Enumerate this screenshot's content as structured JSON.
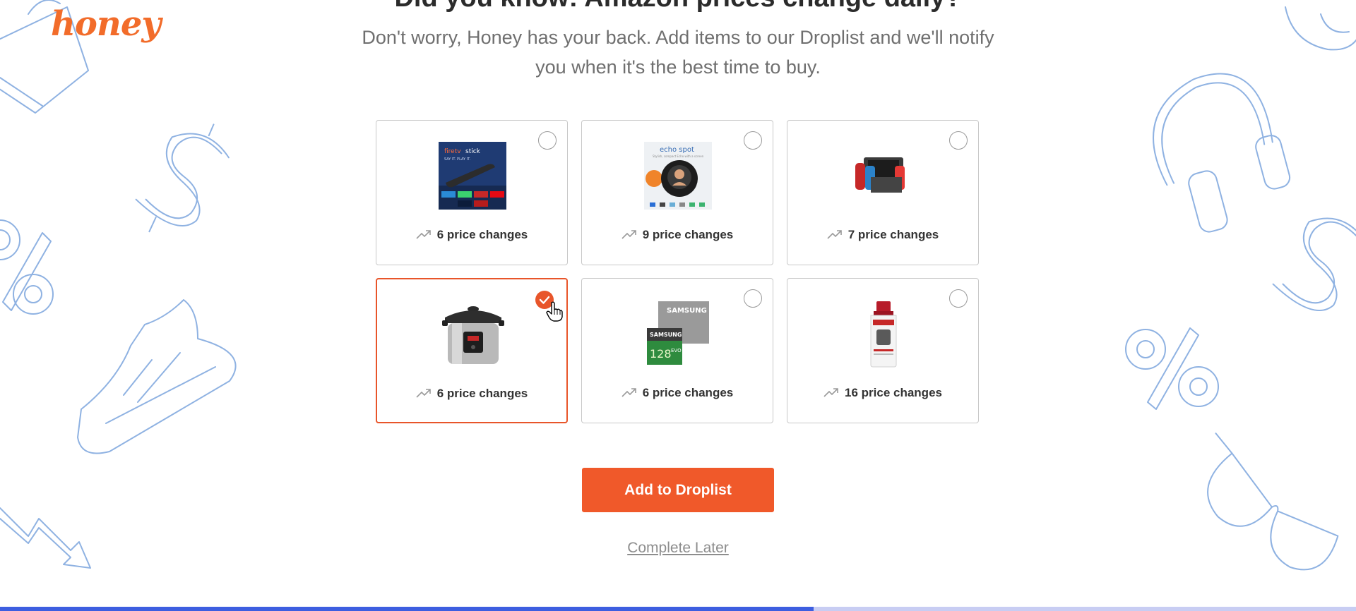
{
  "brand": {
    "logo_text": "honey",
    "accent_color": "#f0592a",
    "selected_border_color": "#e8552a"
  },
  "header": {
    "headline": "Did you know: Amazon prices change daily?",
    "subtext": "Don't worry, Honey has your back. Add items to our Droplist and we'll notify you when it's the best time to buy."
  },
  "products": [
    {
      "id": "fire-tv-stick",
      "price_changes": "6 price changes",
      "selected": false,
      "image_icon": "fire-tv-stick-box-icon"
    },
    {
      "id": "echo-spot",
      "price_changes": "9 price changes",
      "selected": false,
      "image_icon": "echo-spot-box-icon"
    },
    {
      "id": "nintendo-switch",
      "price_changes": "7 price changes",
      "selected": false,
      "image_icon": "nintendo-switch-icon"
    },
    {
      "id": "instant-pot",
      "price_changes": "6 price changes",
      "selected": true,
      "image_icon": "instant-pot-icon"
    },
    {
      "id": "samsung-microsd",
      "price_changes": "6 price changes",
      "selected": false,
      "image_icon": "samsung-microsd-card-icon"
    },
    {
      "id": "thayers-toner",
      "price_changes": "16 price changes",
      "selected": false,
      "image_icon": "toner-bottle-icon"
    }
  ],
  "actions": {
    "add_to_droplist": "Add to Droplist",
    "complete_later": "Complete Later"
  },
  "progress": {
    "fraction": 0.6,
    "fill_color": "#3d5ee0",
    "track_color": "#c8cdf3"
  },
  "background": {
    "doodle_color": "#8fb2e2",
    "doodles": [
      "shopping-bag-icon",
      "dollar-sign-icon",
      "percent-icon",
      "sneaker-icon",
      "trend-down-arrow-icon",
      "headphones-icon",
      "sunglasses-icon"
    ]
  }
}
